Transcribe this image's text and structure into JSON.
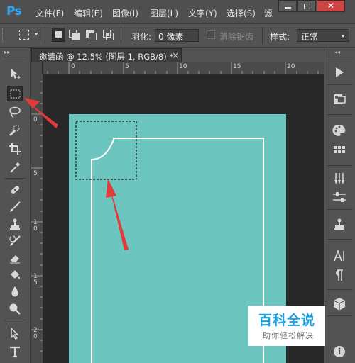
{
  "app": {
    "logo": "Ps"
  },
  "menu": {
    "items": [
      "文件(F)",
      "编辑(E)",
      "图像(I)",
      "图层(L)",
      "文字(Y)",
      "选择(S)",
      "滤"
    ]
  },
  "window_controls": {
    "minimize": "▬",
    "restore": "☐",
    "close": "✕"
  },
  "options_bar": {
    "feather_label": "羽化:",
    "feather_value": "0 像素",
    "antialias_label": "消除锯齿",
    "style_label": "样式:",
    "style_value": "正常"
  },
  "document_tab": {
    "title": "邀请函 @ 12.5% (图层 1, RGB/8) *",
    "close": "×"
  },
  "ruler": {
    "top_ticks": [
      "0",
      "5",
      "10",
      "15",
      "20"
    ],
    "left_ticks": [
      "0",
      "5",
      "1\n0",
      "1\n5",
      "2\n0"
    ]
  },
  "colors": {
    "document_bg": "#6cc5bf",
    "annotation_arrow": "#e23b3b",
    "ps_blue": "#31a8ff"
  },
  "icons": {
    "toolbar": [
      "move-icon",
      "marquee-icon",
      "lasso-icon",
      "quick-select-icon",
      "crop-icon",
      "eyedropper-icon",
      "healing-brush-icon",
      "brush-icon",
      "stamp-icon",
      "history-brush-icon",
      "eraser-icon",
      "paint-bucket-icon",
      "blur-icon",
      "dodge-icon",
      "path-select-icon",
      "type-icon"
    ],
    "dock": [
      "play-icon",
      "layers-comp-icon",
      "color-icon",
      "swatches-icon",
      "brushes-icon",
      "adjust-icon",
      "clone-source-icon",
      "character-icon",
      "paragraph-icon",
      "3d-icon",
      "info-icon"
    ]
  },
  "watermark": {
    "title": "百科全说",
    "subtitle": "助你轻松解决"
  }
}
